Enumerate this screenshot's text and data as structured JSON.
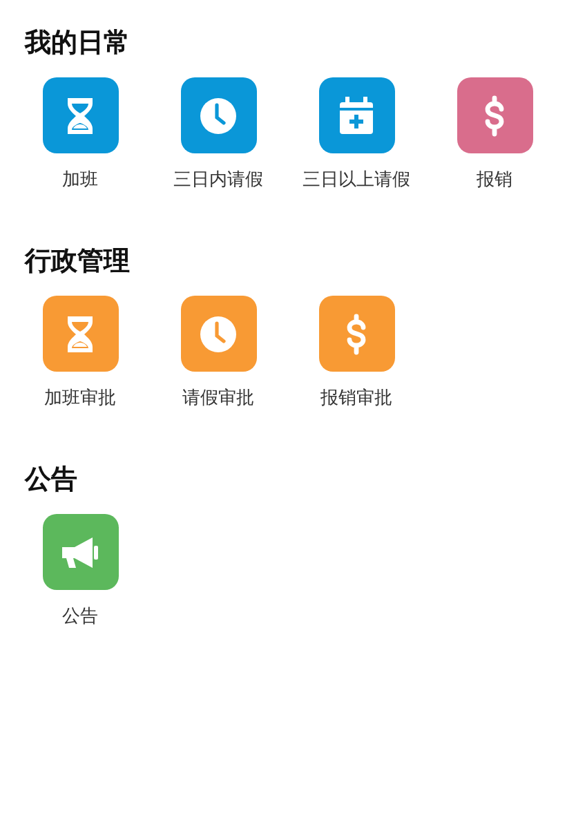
{
  "sections": [
    {
      "title": "我的日常",
      "items": [
        {
          "label": "加班",
          "kind": "hourglass",
          "color": "#0a97d8"
        },
        {
          "label": "三日内请假",
          "kind": "clock",
          "color": "#0a97d8"
        },
        {
          "label": "三日以上请假",
          "kind": "calendar",
          "color": "#0a97d8"
        },
        {
          "label": "报销",
          "kind": "dollar",
          "color": "#d96d8c"
        }
      ]
    },
    {
      "title": "行政管理",
      "items": [
        {
          "label": "加班审批",
          "kind": "hourglass",
          "color": "#f89a34"
        },
        {
          "label": "请假审批",
          "kind": "clock",
          "color": "#f89a34"
        },
        {
          "label": "报销审批",
          "kind": "dollar",
          "color": "#f89a34"
        }
      ]
    },
    {
      "title": "公告",
      "items": [
        {
          "label": "公告",
          "kind": "megaphone",
          "color": "#5cb85c"
        }
      ]
    }
  ]
}
